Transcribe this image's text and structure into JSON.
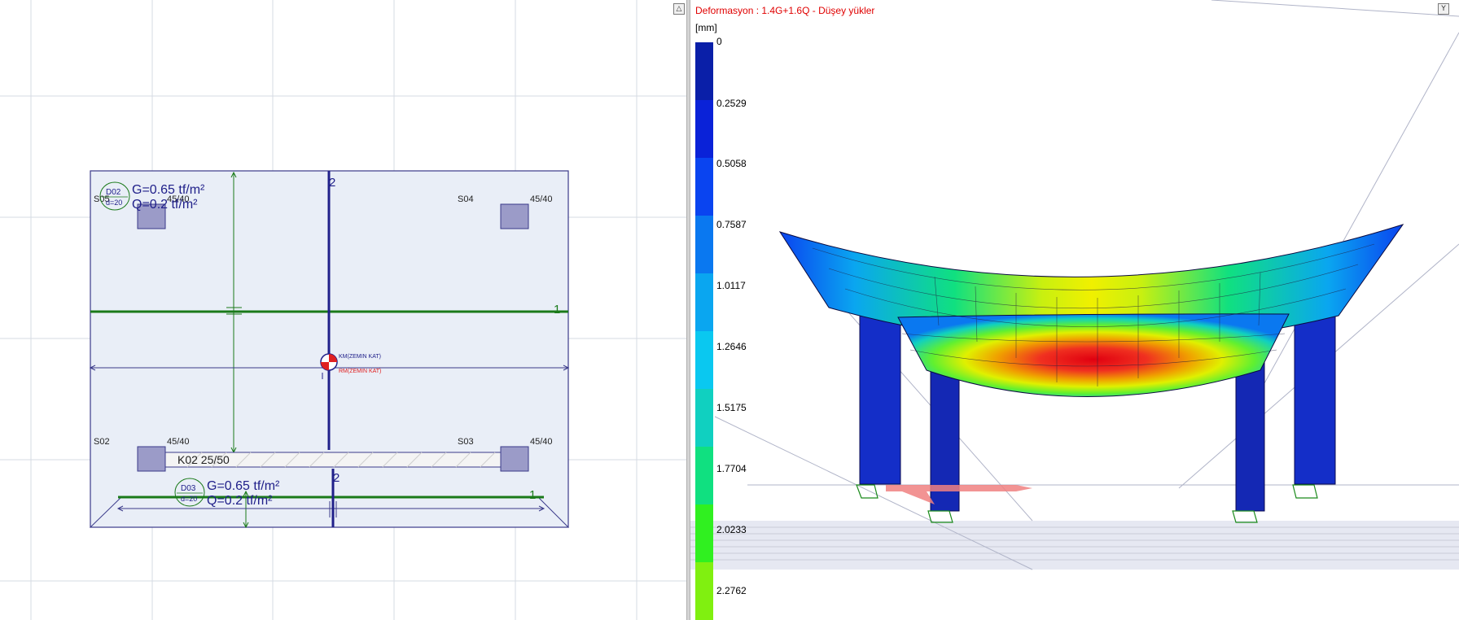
{
  "plan_view": {
    "load_labels": [
      {
        "slab": "D02",
        "thickness": "d=20",
        "g": "G=0.65 tf/m²",
        "q": "Q=0.2 tf/m²"
      },
      {
        "slab": "D03",
        "thickness": "d=20",
        "g": "G=0.65 tf/m²",
        "q": "Q=0.2 tf/m²"
      }
    ],
    "columns": [
      {
        "name": "S05",
        "size": "45/40"
      },
      {
        "name": "S04",
        "size": "45/40"
      },
      {
        "name": "S02",
        "size": "45/40"
      },
      {
        "name": "S03",
        "size": "45/40"
      }
    ],
    "beam_label": "K02 25/50",
    "axis_labels": {
      "a2_top": "2",
      "a2_bottom": "2",
      "a1_top": "1",
      "a1_bottom": "1"
    },
    "center_labels": {
      "km": "KM(ZEMIN KAT)",
      "rm": "RM(ZEMIN KAT)"
    }
  },
  "result_view": {
    "title": "Deformasyon : 1.4G+1.6Q  -  Düşey yükler",
    "unit": "[mm]",
    "legend": {
      "values": [
        "0",
        "0.2529",
        "0.5058",
        "0.7587",
        "1.0117",
        "1.2646",
        "1.5175",
        "1.7704",
        "2.0233",
        "2.2762"
      ],
      "colors": [
        "#0a1fa8",
        "#0a22d8",
        "#0a44f0",
        "#0a78f0",
        "#0aa6f0",
        "#0ac8f0",
        "#10d0c0",
        "#10e080",
        "#30f020",
        "#80f010"
      ]
    }
  },
  "colors": {
    "plan_bg": "#e9eef7",
    "plan_border": "#3a3a8a",
    "axis_green": "#1a7a1a",
    "axis_blue": "#20208a",
    "title_red": "#e00000"
  },
  "buttons": {
    "left_pane_toggle": "△",
    "right_pane_toggle": "Y"
  }
}
